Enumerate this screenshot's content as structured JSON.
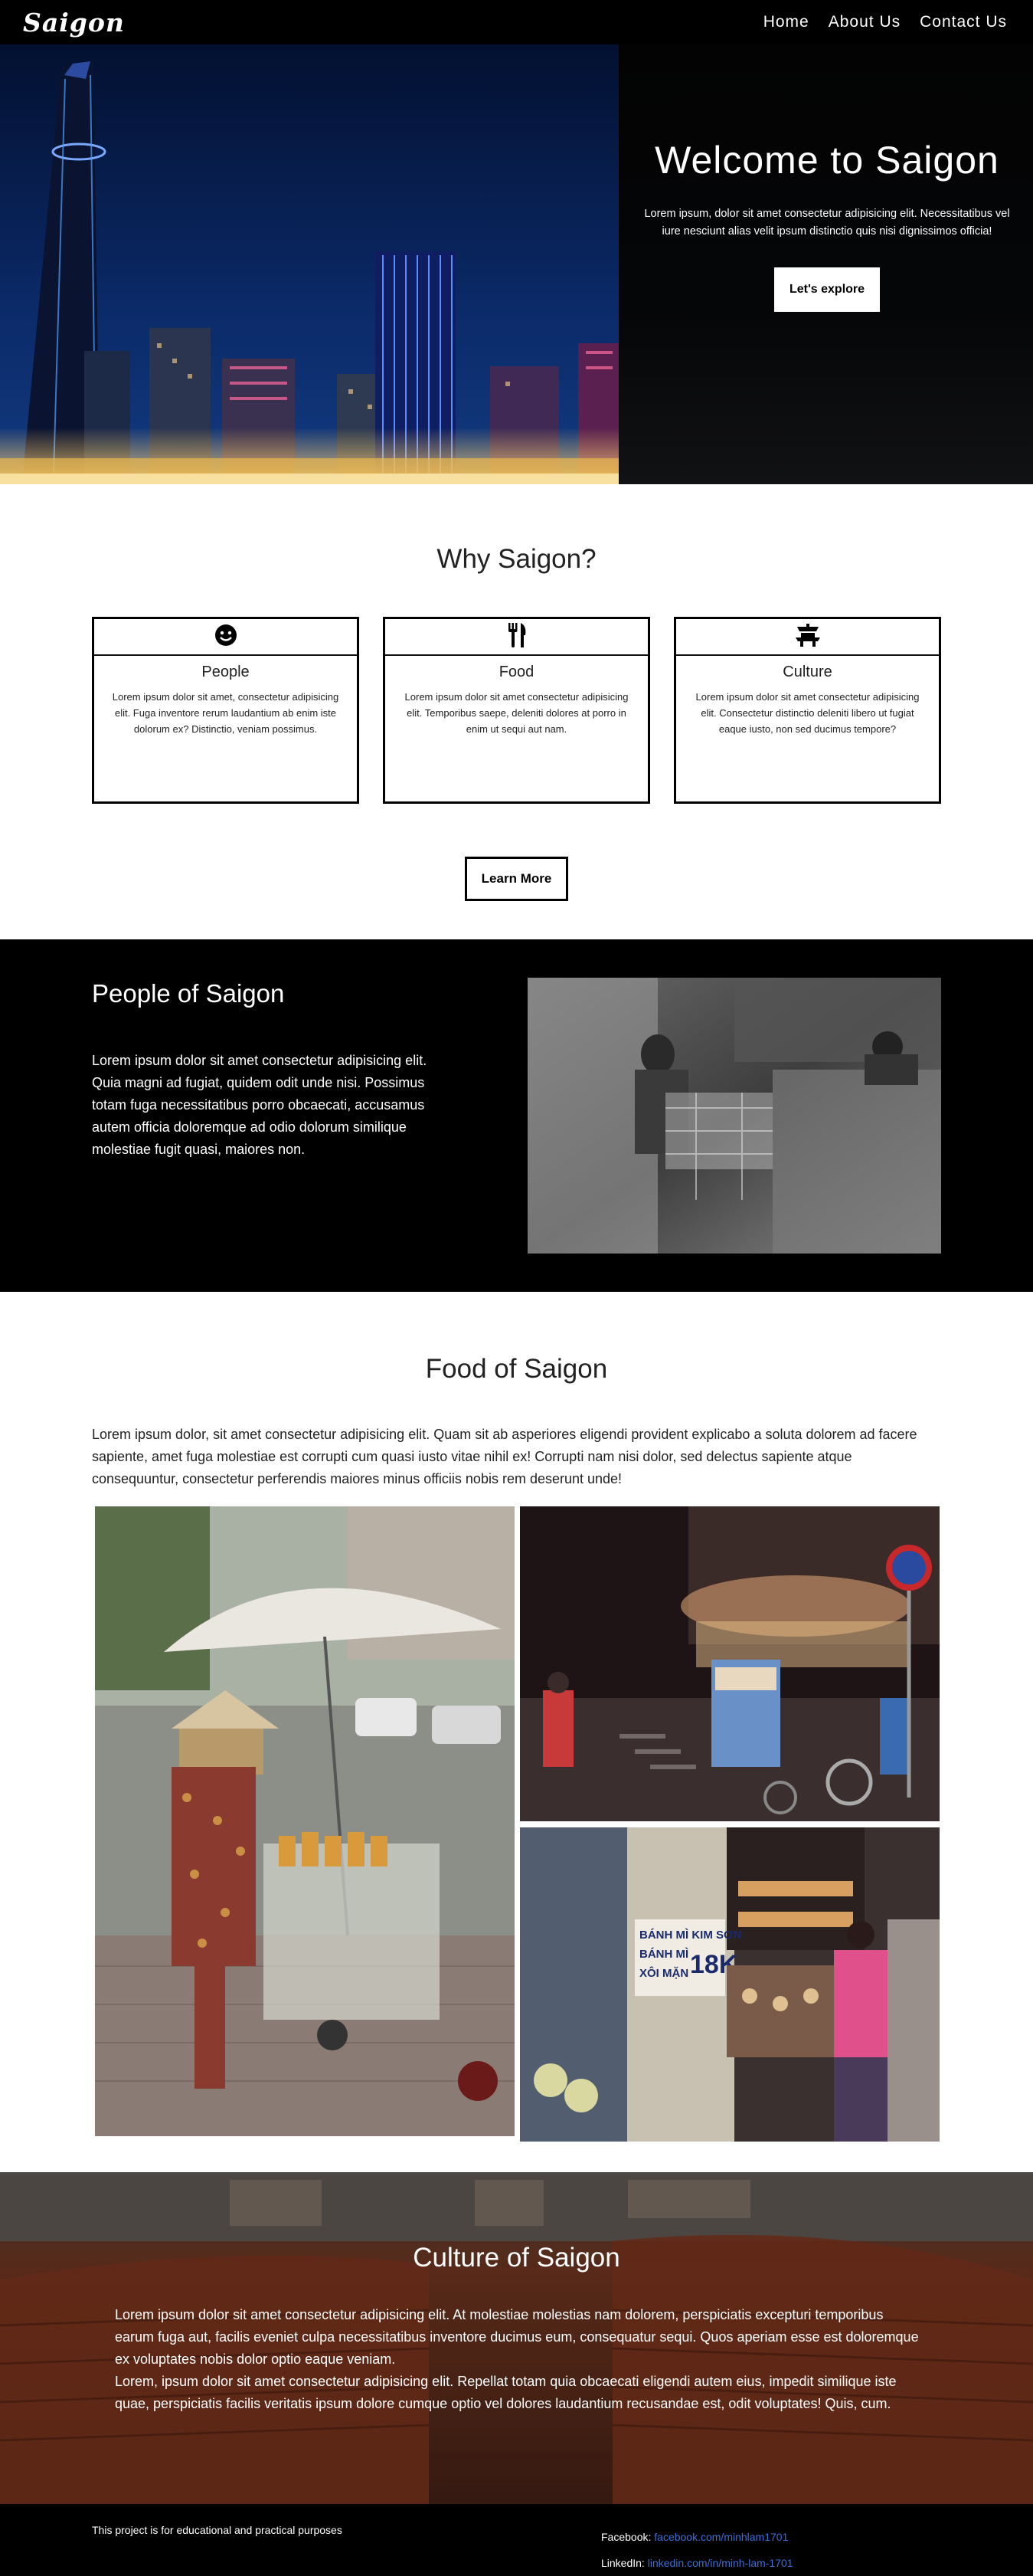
{
  "nav": {
    "brand": "Saigon",
    "links": [
      "Home",
      "About Us",
      "Contact Us"
    ]
  },
  "hero": {
    "title": "Welcome to Saigon",
    "description": "Lorem ipsum, dolor sit amet consectetur adipisicing elit. Necessitatibus vel iure nesciunt alias velit ipsum distinctio quis nisi dignissimos officia!",
    "button": "Let's explore"
  },
  "why": {
    "title": "Why Saigon?",
    "cards": [
      {
        "icon": "smiley-icon",
        "title": "People",
        "text": "Lorem ipsum dolor sit amet, consectetur adipisicing elit. Fuga inventore rerum laudantium ab enim iste dolorum ex? Distinctio, veniam possimus."
      },
      {
        "icon": "fork-knife-icon",
        "title": "Food",
        "text": "Lorem ipsum dolor sit amet consectetur adipisicing elit. Temporibus saepe, deleniti dolores at porro in enim ut sequi aut nam."
      },
      {
        "icon": "pagoda-icon",
        "title": "Culture",
        "text": "Lorem ipsum dolor sit amet consectetur adipisicing elit. Consectetur distinctio deleniti libero ut fugiat eaque iusto, non sed ducimus tempore?"
      }
    ],
    "button": "Learn More"
  },
  "people": {
    "title": "People of Saigon",
    "text": "Lorem ipsum dolor sit amet consectetur adipisicing elit. Quia magni ad fugiat, quidem odit unde nisi. Possimus totam fuga necessitatibus porro obcaecati, accusamus autem officia doloremque ad odio dolorum similique molestiae fugit quasi, maiores non."
  },
  "food": {
    "title": "Food of Saigon",
    "text": "Lorem ipsum dolor, sit amet consectetur adipisicing elit. Quam sit ab asperiores eligendi provident explicabo a soluta dolorem ad facere sapiente, amet fuga molestiae est corrupti cum quasi iusto vitae nihil ex! Corrupti nam nisi dolor, sed delectus sapiente atque consequuntur, consectetur perferendis maiores minus officiis nobis rem deserunt unde!",
    "sign_lines": [
      "BÁNH MÌ KIM SƠN",
      "BÁNH MÌ",
      "XÔI MẶN",
      "18K"
    ]
  },
  "culture": {
    "title": "Culture of Saigon",
    "text": "Lorem ipsum dolor sit amet consectetur adipisicing elit. At molestiae molestias nam dolorem, perspiciatis excepturi temporibus earum fuga aut, facilis eveniet culpa necessitatibus inventore ducimus eum, consequatur sequi. Quos aperiam esse est doloremque ex voluptates nobis dolor optio eaque veniam.\nLorem, ipsum dolor sit amet consectetur adipisicing elit. Repellat totam quia obcaecati eligendi autem eius, impedit similique iste quae, perspiciatis facilis veritatis ipsum dolore cumque optio vel dolores laudantium recusandae est, odit voluptates! Quis, cum."
  },
  "footer": {
    "note": "This project is for educational and practical purposes",
    "facebook_label": "Facebook:",
    "facebook_link": "facebook.com/minhlam1701",
    "linkedin_label": "LinkedIn:",
    "linkedin_link": "linkedin.com/in/minh-lam-1701"
  },
  "colors": {
    "nav_bg": "#000000",
    "link": "#3b6fd6",
    "card_border": "#000000"
  }
}
